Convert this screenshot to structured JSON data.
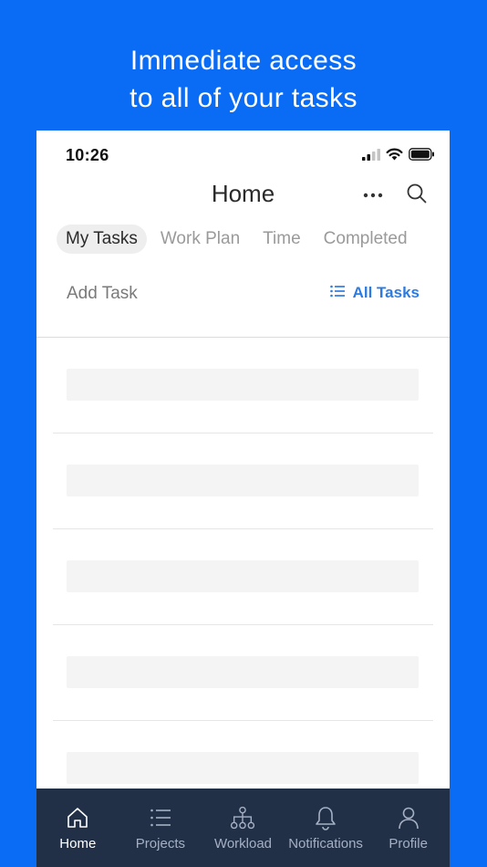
{
  "promo": {
    "line1": "Immediate access",
    "line2": "to all of your tasks"
  },
  "status_bar": {
    "time": "10:26",
    "icons": [
      "cellular-signal-icon",
      "wifi-icon",
      "battery-icon"
    ]
  },
  "nav": {
    "title": "Home",
    "more_icon": "more-horizontal-icon",
    "search_icon": "search-icon"
  },
  "tabs": [
    {
      "label": "My Tasks",
      "active": true
    },
    {
      "label": "Work Plan",
      "active": false
    },
    {
      "label": "Time",
      "active": false
    },
    {
      "label": "Completed",
      "active": false
    }
  ],
  "actions": {
    "add_task": "Add Task",
    "all_tasks": "All Tasks",
    "all_tasks_icon": "list-icon"
  },
  "task_list": {
    "placeholder_rows": 5
  },
  "bottom_nav": [
    {
      "label": "Home",
      "icon": "home-icon",
      "active": true
    },
    {
      "label": "Projects",
      "icon": "list-icon",
      "active": false
    },
    {
      "label": "Workload",
      "icon": "hierarchy-icon",
      "active": false
    },
    {
      "label": "Notifications",
      "icon": "bell-icon",
      "active": false
    },
    {
      "label": "Profile",
      "icon": "person-icon",
      "active": false
    }
  ],
  "colors": {
    "background": "#0a6cf5",
    "accent": "#2d7be0",
    "tab_bar": "#223047",
    "active_tab_bg": "#eeeeee"
  }
}
